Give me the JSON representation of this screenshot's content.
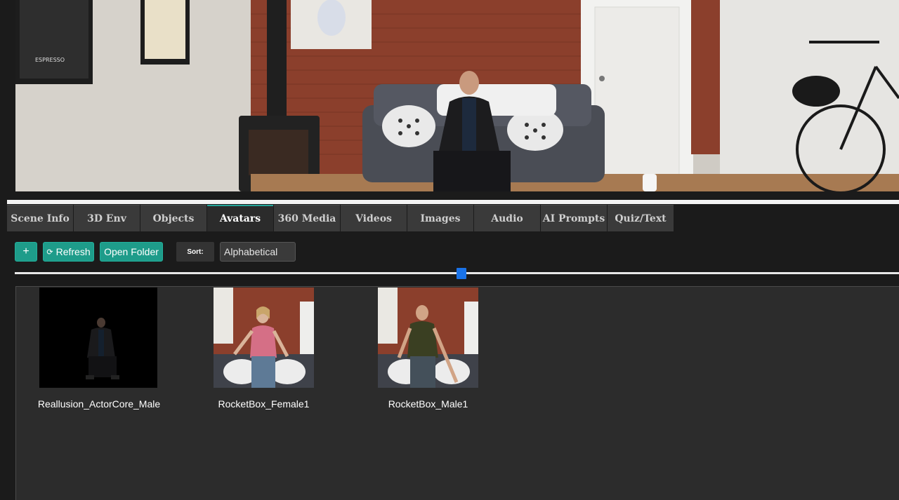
{
  "tabs": [
    {
      "label": "Scene Info"
    },
    {
      "label": "3D Env"
    },
    {
      "label": "Objects"
    },
    {
      "label": "Avatars"
    },
    {
      "label": "360 Media"
    },
    {
      "label": "Videos"
    },
    {
      "label": "Images"
    },
    {
      "label": "Audio"
    },
    {
      "label": "AI Prompts"
    },
    {
      "label": "Quiz/Text"
    }
  ],
  "active_tab": "Avatars",
  "toolbar": {
    "add_label": "+",
    "refresh_label": "Refresh",
    "open_folder_label": "Open Folder",
    "sort_label": "Sort:",
    "sort_value": "Alphabetical"
  },
  "scene": {
    "poster_text": "ESPRESSO"
  },
  "avatars": [
    {
      "name": "Reallusion_ActorCore_Male"
    },
    {
      "name": "RocketBox_Female1"
    },
    {
      "name": "RocketBox_Male1"
    }
  ],
  "colors": {
    "accent": "#1e9c8a",
    "slider_thumb": "#1a73e8",
    "panel_bg": "#2c2c2c"
  }
}
